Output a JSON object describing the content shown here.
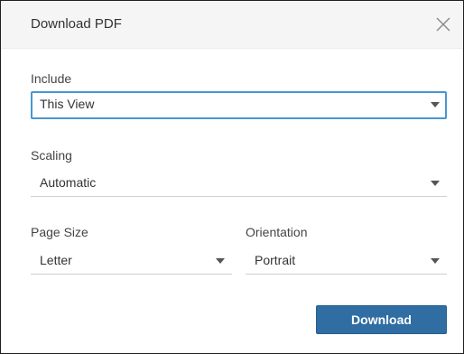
{
  "dialog": {
    "title": "Download PDF",
    "close_icon": "close-icon"
  },
  "include": {
    "label": "Include",
    "value": "This View"
  },
  "scaling": {
    "label": "Scaling",
    "value": "Automatic"
  },
  "page_size": {
    "label": "Page Size",
    "value": "Letter"
  },
  "orientation": {
    "label": "Orientation",
    "value": "Portrait"
  },
  "actions": {
    "download_label": "Download"
  },
  "colors": {
    "focus_border": "#4996d1",
    "primary_button": "#2f6da3",
    "titlebar_bg": "#f5f5f5"
  }
}
